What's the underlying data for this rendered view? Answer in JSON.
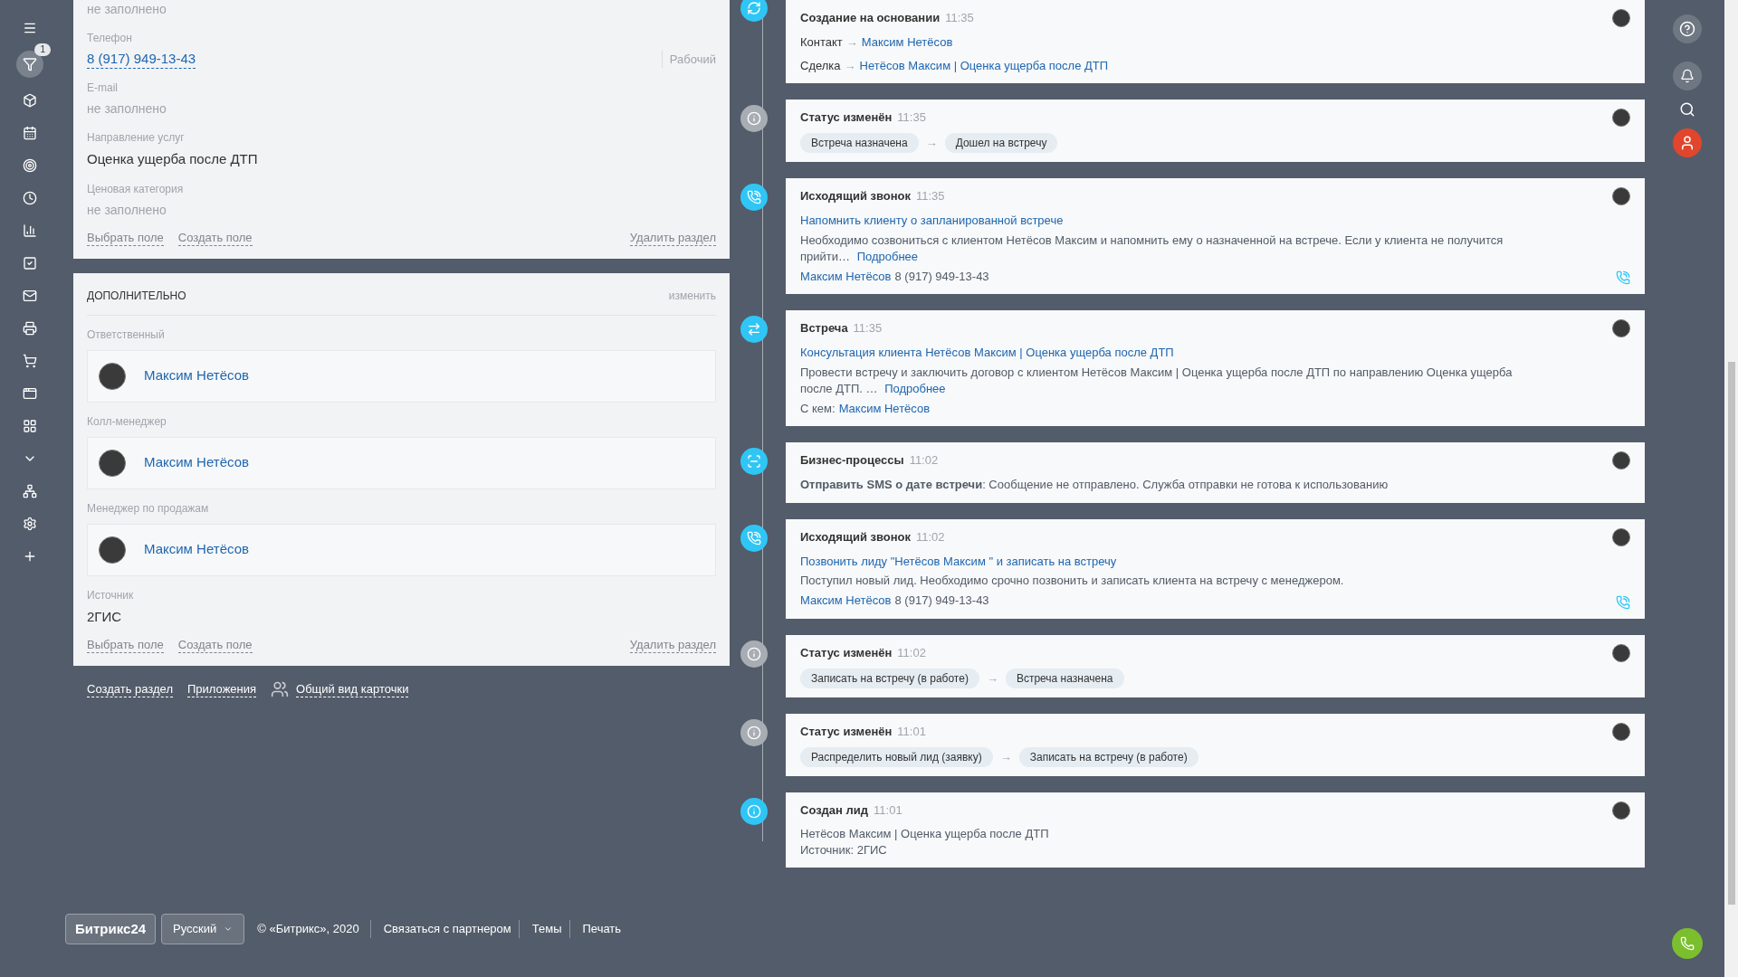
{
  "sidebar": {
    "items": [
      {
        "selected": false
      },
      {
        "selected": true,
        "badge": "1"
      },
      {
        "selected": false
      },
      {
        "selected": false
      },
      {
        "selected": false
      },
      {
        "selected": false
      },
      {
        "selected": false
      },
      {
        "selected": false
      },
      {
        "selected": false
      },
      {
        "selected": false
      },
      {
        "selected": false
      },
      {
        "selected": false
      },
      {
        "selected": false
      },
      {
        "selected": false
      },
      {
        "selected": false
      },
      {
        "selected": false
      },
      {
        "selected": false
      }
    ]
  },
  "main_section": {
    "fields": [
      {
        "kind": "empty",
        "value": "не заполнено"
      },
      {
        "kind": "phone",
        "label": "Телефон",
        "value": "8 (917) 949-13-43",
        "type": "Рабочий"
      },
      {
        "kind": "empty",
        "label": "E-mail",
        "value": "не заполнено"
      },
      {
        "kind": "text",
        "label": "Направление услуг",
        "value": "Оценка ущерба после ДТП"
      },
      {
        "kind": "empty",
        "label": "Ценовая категория",
        "value": "не заполнено"
      }
    ],
    "actions": [
      "Выбрать поле",
      "Создать поле"
    ],
    "delete": "Удалить раздел"
  },
  "extra_section": {
    "title": "ДОПОЛНИТЕЛЬНО",
    "edit": "изменить",
    "fields": [
      {
        "kind": "user",
        "label": "Ответственный",
        "value": "Максим Нетёсов"
      },
      {
        "kind": "user",
        "label": "Колл-менеджер",
        "value": "Максим Нетёсов"
      },
      {
        "kind": "user",
        "label": "Менеджер по продажам",
        "value": "Максим Нетёсов"
      },
      {
        "kind": "text",
        "label": "Источник",
        "value": "2ГИС"
      }
    ],
    "actions": [
      "Выбрать поле",
      "Создать поле"
    ],
    "delete": "Удалить раздел"
  },
  "card_links": [
    "Создать раздел",
    "Приложения"
  ],
  "card_view": "Общий вид карточки",
  "timeline": [
    {
      "kind": "links",
      "color": "#2fc6f6",
      "title": "Создание на основании",
      "time": "11:35",
      "rows": [
        {
          "label": "Контакт",
          "arrow": "→",
          "link": "Максим Нетёсов"
        },
        {
          "label": "Сделка",
          "arrow": "→",
          "link": "Нетёсов Максим | Оценка ущерба после ДТП"
        }
      ]
    },
    {
      "kind": "status",
      "color": "#a8adb4",
      "title": "Статус изменён",
      "time": "11:35",
      "from": "Встреча назначена",
      "arrow": "→",
      "to": "Дошел на встречу"
    },
    {
      "kind": "call",
      "color": "#2fc6f6",
      "title": "Исходящий звонок",
      "time": "11:35",
      "subject": "Напомнить клиенту о запланированной встрече",
      "text": "Необходимо созвониться с клиентом Нетёсов Максим и напомнить ему о назначенной на встрече. Если у клиента не получится прийти…",
      "more": "Подробнее",
      "contact": "Максим Нетёсов",
      "phone": "8 (917) 949-13-43"
    },
    {
      "kind": "meeting",
      "color": "#2fc6f6",
      "title": "Встреча",
      "time": "11:35",
      "subject": "Консультация клиента Нетёсов Максим | Оценка ущерба после ДТП",
      "text": "Провести встречу и заключить договор с клиентом Нетёсов Максим | Оценка ущерба после ДТП по направлению Оценка ущерба после ДТП. …",
      "more": "Подробнее",
      "with_label": "С кем:",
      "contact": "Максим Нетёсов"
    },
    {
      "kind": "process",
      "color": "#2fc6f6",
      "title": "Бизнес-процессы",
      "time": "11:02",
      "text": "**Отправить SMS о дате встречи**: Сообщение не отправлено. Служба отправки не готова к использованию"
    },
    {
      "kind": "call",
      "color": "#2fc6f6",
      "title": "Исходящий звонок",
      "time": "11:02",
      "subject": "Позвонить лиду \"Нетёсов Максим \" и записать на встречу",
      "text": "Поступил новый лид. Необходимо срочно позвонить и записать клиента на встречу с менеджером.",
      "contact": "Максим Нетёсов",
      "phone": "8 (917) 949-13-43"
    },
    {
      "kind": "status",
      "color": "#a8adb4",
      "title": "Статус изменён",
      "time": "11:02",
      "from": "Записать на встречу (в работе)",
      "arrow": "→",
      "to": "Встреча назначена"
    },
    {
      "kind": "status",
      "color": "#a8adb4",
      "title": "Статус изменён",
      "time": "11:01",
      "from": "Распределить новый лид (заявку)",
      "arrow": "→",
      "to": "Записать на встречу (в работе)"
    },
    {
      "kind": "created",
      "color": "#2fc6f6",
      "title": "Создан лид",
      "time": "11:01",
      "lines": [
        "Нетёсов Максим | Оценка ущерба после ДТП",
        "Источник: 2ГИС"
      ]
    }
  ],
  "footer": {
    "logo": "Битрикс24",
    "language": "Русский",
    "copyright": "© «Битрикс», 2020",
    "links": [
      "Связаться с партнером",
      "Темы",
      "Печать"
    ]
  }
}
